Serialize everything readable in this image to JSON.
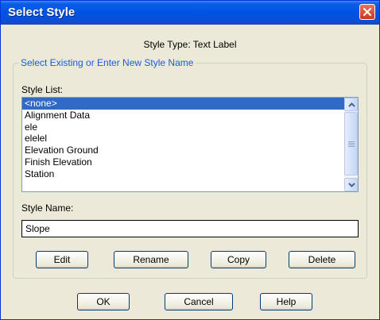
{
  "window": {
    "title": "Select Style"
  },
  "style_type": "Style Type: Text Label",
  "group": {
    "legend": "Select Existing or Enter New Style Name",
    "style_list_label": "Style List:",
    "style_list": [
      {
        "label": "<none>",
        "selected": true
      },
      {
        "label": "Alignment Data",
        "selected": false
      },
      {
        "label": "ele",
        "selected": false
      },
      {
        "label": "elelel",
        "selected": false
      },
      {
        "label": "Elevation Ground",
        "selected": false
      },
      {
        "label": "Finish Elevation",
        "selected": false
      },
      {
        "label": "Station",
        "selected": false
      }
    ],
    "style_name_label": "Style Name:",
    "style_name_value": "Slope",
    "buttons": {
      "edit": "Edit",
      "rename": "Rename",
      "copy": "Copy",
      "delete": "Delete"
    }
  },
  "footer": {
    "ok": "OK",
    "cancel": "Cancel",
    "help": "Help"
  },
  "colors": {
    "titlebar": "#0054e3",
    "selection": "#316ac5",
    "legend_text": "#1b5bd8",
    "close_button": "#c73b1c"
  },
  "icons": {
    "close": "close-icon",
    "scroll_up": "chevron-up-icon",
    "scroll_down": "chevron-down-icon"
  }
}
